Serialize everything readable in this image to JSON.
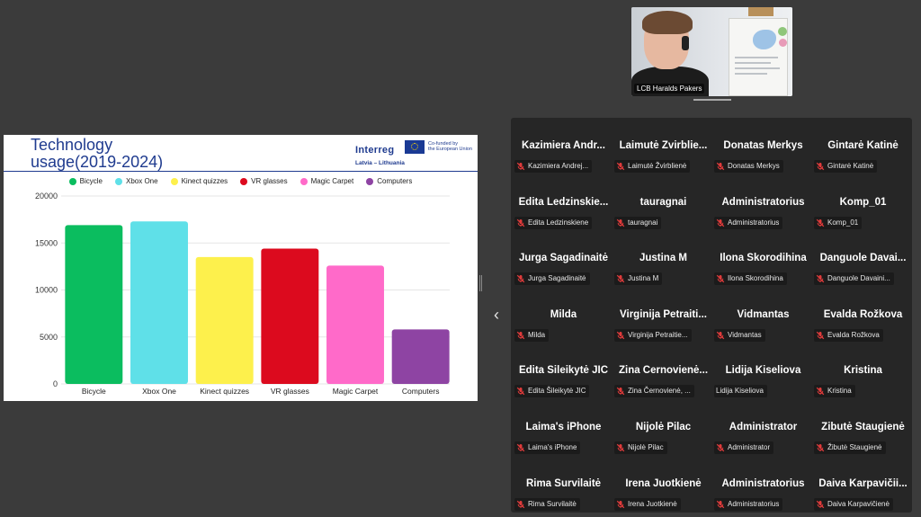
{
  "presenter": {
    "name": "LCB Haralds Pakers"
  },
  "slide": {
    "title": "Technology\nusage(2019-2024)",
    "logo": {
      "wordmark": "Interreg",
      "subtitle": "Latvia – Lithuania",
      "eu_text": "Co-funded by\nthe European Union"
    }
  },
  "chart_data": {
    "type": "bar",
    "categories": [
      "Bicycle",
      "Xbox One",
      "Kinect quizzes",
      "VR glasses",
      "Magic Carpet",
      "Computers"
    ],
    "values": [
      16900,
      17300,
      13500,
      14400,
      12600,
      5800
    ],
    "colors": [
      "#0bbd5f",
      "#5fe0e8",
      "#fdf04c",
      "#dc0a1e",
      "#ff6ac9",
      "#8e44a3"
    ],
    "ylim": [
      0,
      20000
    ],
    "yticks": [
      0,
      5000,
      10000,
      15000,
      20000
    ],
    "legend_position": "top",
    "grid": true
  },
  "participants": [
    {
      "name": "Kazimiera Andr...",
      "tag": "Kazimiera Andrej...",
      "muted": true
    },
    {
      "name": "Laimutė Žvirblie...",
      "tag": "Laimutė Žvirblienė",
      "muted": true
    },
    {
      "name": "Donatas Merkys",
      "tag": "Donatas Merkys",
      "muted": true
    },
    {
      "name": "Gintarė Katinė",
      "tag": "Gintarė Katinė",
      "muted": true
    },
    {
      "name": "Edita Ledzinskie...",
      "tag": "Edita Ledzinskiene",
      "muted": true
    },
    {
      "name": "tauragnai",
      "tag": "tauragnai",
      "muted": true
    },
    {
      "name": "Administratorius",
      "tag": "Administratorius",
      "muted": true
    },
    {
      "name": "Komp_01",
      "tag": "Komp_01",
      "muted": true
    },
    {
      "name": "Jurga Sagadinaitė",
      "tag": "Jurga Sagadinaitė",
      "muted": true
    },
    {
      "name": "Justina M",
      "tag": "Justina M",
      "muted": true
    },
    {
      "name": "Ilona Skorodihina",
      "tag": "Ilona Skorodihina",
      "muted": true
    },
    {
      "name": "Danguole Davai...",
      "tag": "Danguole Davaini...",
      "muted": true
    },
    {
      "name": "Milda",
      "tag": "Milda",
      "muted": true
    },
    {
      "name": "Virginija Petraiti...",
      "tag": "Virginija Petraitie...",
      "muted": true
    },
    {
      "name": "Vidmantas",
      "tag": "Vidmantas",
      "muted": true
    },
    {
      "name": "Evalda Rožkova",
      "tag": "Evalda Rožkova",
      "muted": true
    },
    {
      "name": "Edita Šileikytė JIC",
      "tag": "Edita Šileikytė JIC",
      "muted": true
    },
    {
      "name": "Zina Černovienė...",
      "tag": "Zina Černovienė, ...",
      "muted": true
    },
    {
      "name": "Lidija Kiseliova",
      "tag": "Lidija Kiseliova",
      "muted": false
    },
    {
      "name": "Kristina",
      "tag": "Kristina",
      "muted": true
    },
    {
      "name": "Laima's iPhone",
      "tag": "Laima's iPhone",
      "muted": true
    },
    {
      "name": "Nijolė Pilac",
      "tag": "Nijolė Pilac",
      "muted": true
    },
    {
      "name": "Administrator",
      "tag": "Administrator",
      "muted": true
    },
    {
      "name": "Žibutė Staugienė",
      "tag": "Žibutė Staugienė",
      "muted": true
    },
    {
      "name": "Rima Survilaitė",
      "tag": "Rima Survilaitė",
      "muted": true
    },
    {
      "name": "Irena Juotkienė",
      "tag": "Irena Juotkienė",
      "muted": true
    },
    {
      "name": "Administratorius",
      "tag": "Administratorius",
      "muted": true
    },
    {
      "name": "Daiva Karpavičiі...",
      "tag": "Daiva Karpavičienė",
      "muted": true
    }
  ],
  "controls": {
    "collapse_icon": "chevron-left-icon",
    "handle_icon": "resize-handle-icon"
  },
  "colors": {
    "mute_red": "#e03b3b",
    "panel_bg": "#262626",
    "title_blue": "#1f3b8f"
  }
}
